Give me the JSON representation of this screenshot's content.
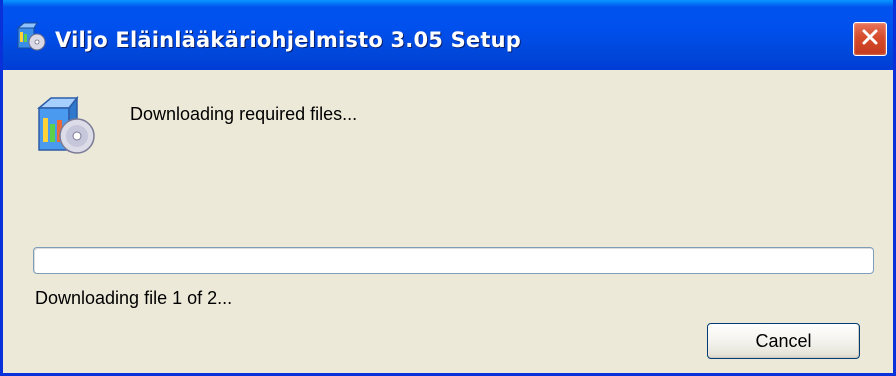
{
  "window": {
    "title": "Viljo Eläinlääkäriohjelmisto 3.05 Setup",
    "icon": "setup-installer-icon"
  },
  "titlebar": {
    "close_icon": "close-icon",
    "colors": {
      "titlebar_blue": "#0053ee",
      "close_red": "#d64b2c"
    }
  },
  "main": {
    "heading": "Downloading required files...",
    "status": "Downloading file 1 of 2...",
    "progress_percent": 0
  },
  "buttons": {
    "cancel_label": "Cancel"
  }
}
